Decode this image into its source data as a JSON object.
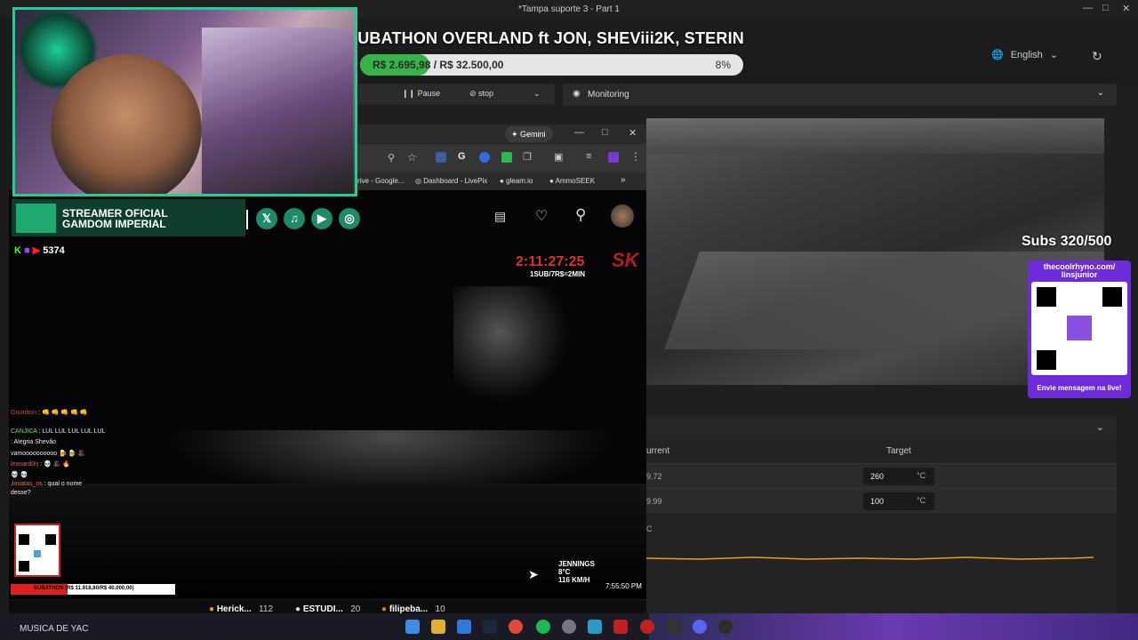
{
  "window": {
    "title": "*Tampa suporte 3 - Part 1"
  },
  "overlay": {
    "title": "SUBATHON OVERLAND ft JON, SHEViii2K, STERIN",
    "progress_text": "R$ 2.695,98 / R$ 32.500,00",
    "progress_percent_text": "8%",
    "progress_fraction": 0.08,
    "subs": "Subs 320/500",
    "qr_url": "thecoolrhyno.com/ linsjunior",
    "qr_cta": "Envie mensagem na live!"
  },
  "app": {
    "language": "English",
    "pause_label": "Pause",
    "stop_label": "stop",
    "monitoring_label": "Monitoring",
    "temp_header_current": "urrent",
    "temp_header_target": "Target",
    "rows": [
      {
        "current": "9.72",
        "target": "260",
        "unit": "°C"
      },
      {
        "current": "9.99",
        "target": "100",
        "unit": "°C"
      }
    ],
    "graph_label": "C"
  },
  "browser": {
    "gemini": "Gemini",
    "bookmarks": [
      "rive - Google...",
      "Dashboard - LivePix",
      "gleam.io",
      "AmmoSEEK"
    ]
  },
  "stream": {
    "banner_line1": "STREAMER OFICIAL",
    "banner_line2": "GAMDOM IMPERIAL",
    "viewers": "5374",
    "timer": "2:11:27:25",
    "timer_rate": "1SUB/7R$=2MIN",
    "hud_line1": "JENNINGS",
    "hud_line2": "8°C",
    "hud_line3": "116 KM/H",
    "clock": "7:55:50 PM",
    "sub_bar_text": "SUBATHON (R$ 11.918,80/R$ 40.000,00)",
    "chat": [
      {
        "user": "Grumbon",
        "msg": ": 👊 👊 👊 👊 👊"
      },
      {
        "user": "CANJICA",
        "msg": ": LUL LUL LUL LUL LUL"
      },
      {
        "user": "",
        "msg": ": Alegria Shevão"
      },
      {
        "user": "",
        "msg": "vamoooooooooo 🍺 🍺 🎩"
      },
      {
        "user": "leonard0rj",
        "msg": ": 💀 🎩 🔥"
      },
      {
        "user": "",
        "msg": "💀 💀"
      },
      {
        "user": "Jonatas_ns",
        "msg": ": qual o nome"
      },
      {
        "user": "",
        "msg": "desse?"
      }
    ]
  },
  "rankings": [
    {
      "name": "Herick...",
      "value": "112"
    },
    {
      "name": "ESTUDI...",
      "value": "20"
    },
    {
      "name": "filipeba...",
      "value": "10"
    }
  ],
  "taskbar": {
    "ticker": "MUSICA DE YAC"
  }
}
